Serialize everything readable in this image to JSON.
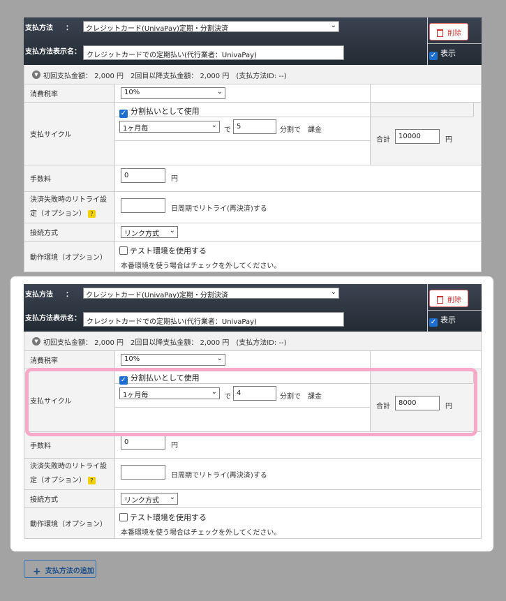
{
  "blocks": [
    {
      "payment_method_label": "支払方法",
      "payment_method_value": "クレジットカード(UnivaPay)定期・分割決済",
      "display_name_label": "支払方法表示名",
      "display_name_value": "クレジットカードでの定期払い(代行業者：UnivaPay)",
      "delete_label": "削除",
      "show_label": "表示",
      "summary_text": "初回支払金額： 2,000 円　2回目以降支払金額： 2,000 円　(支払方法ID: --)",
      "tax_label": "消費税率",
      "tax_value": "10%",
      "cycle_label": "支払サイクル",
      "installment_check_label": "分割払いとして使用",
      "cycle_value": "1ヶ月毎",
      "de_text": "で",
      "installment_count": "5",
      "bunkatsu_text": "分割で　課金",
      "total_label": "合計",
      "total_value": "10000",
      "yen": "円",
      "fee_label": "手数料",
      "fee_value": "0",
      "retry_label_1": "決済失敗時のリトライ設",
      "retry_label_2": "定（オプション）",
      "retry_value": "",
      "retry_suffix": "日周期でリトライ(再決済)する",
      "connection_label": "接続方式",
      "connection_value": "リンク方式",
      "env_label": "動作環境（オプション）",
      "env_check_label": "テスト環境を使用する",
      "env_note": "本番環境を使う場合はチェックを外してください。"
    },
    {
      "payment_method_label": "支払方法",
      "payment_method_value": "クレジットカード(UnivaPay)定期・分割決済",
      "display_name_label": "支払方法表示名",
      "display_name_value": "クレジットカードでの定期払い(代行業者：UnivaPay)",
      "delete_label": "削除",
      "show_label": "表示",
      "summary_text": "初回支払金額： 2,000 円　2回目以降支払金額： 2,000 円　(支払方法ID: --)",
      "tax_label": "消費税率",
      "tax_value": "10%",
      "cycle_label": "支払サイクル",
      "installment_check_label": "分割払いとして使用",
      "cycle_value": "1ヶ月毎",
      "de_text": "で",
      "installment_count": "4",
      "bunkatsu_text": "分割で　課金",
      "total_label": "合計",
      "total_value": "8000",
      "yen": "円",
      "fee_label": "手数料",
      "fee_value": "0",
      "retry_label_1": "決済失敗時のリトライ設",
      "retry_label_2": "定（オプション）",
      "retry_value": "",
      "retry_suffix": "日周期でリトライ(再決済)する",
      "connection_label": "接続方式",
      "connection_value": "リンク方式",
      "env_label": "動作環境（オプション）",
      "env_check_label": "テスト環境を使用する",
      "env_note": "本番環境を使う場合はチェックを外してください。"
    }
  ],
  "add_button_label": "支払方法の追加",
  "icons": {
    "delete": "trash-icon",
    "check": "checkmark",
    "collapse": "chevron-down-icon",
    "help": "question-icon",
    "add": "plus-icon"
  },
  "colors": {
    "header_bg": "#2b333d",
    "highlight": "#f7a9c9",
    "delete": "#cc3333",
    "check": "#1c6fd1"
  }
}
